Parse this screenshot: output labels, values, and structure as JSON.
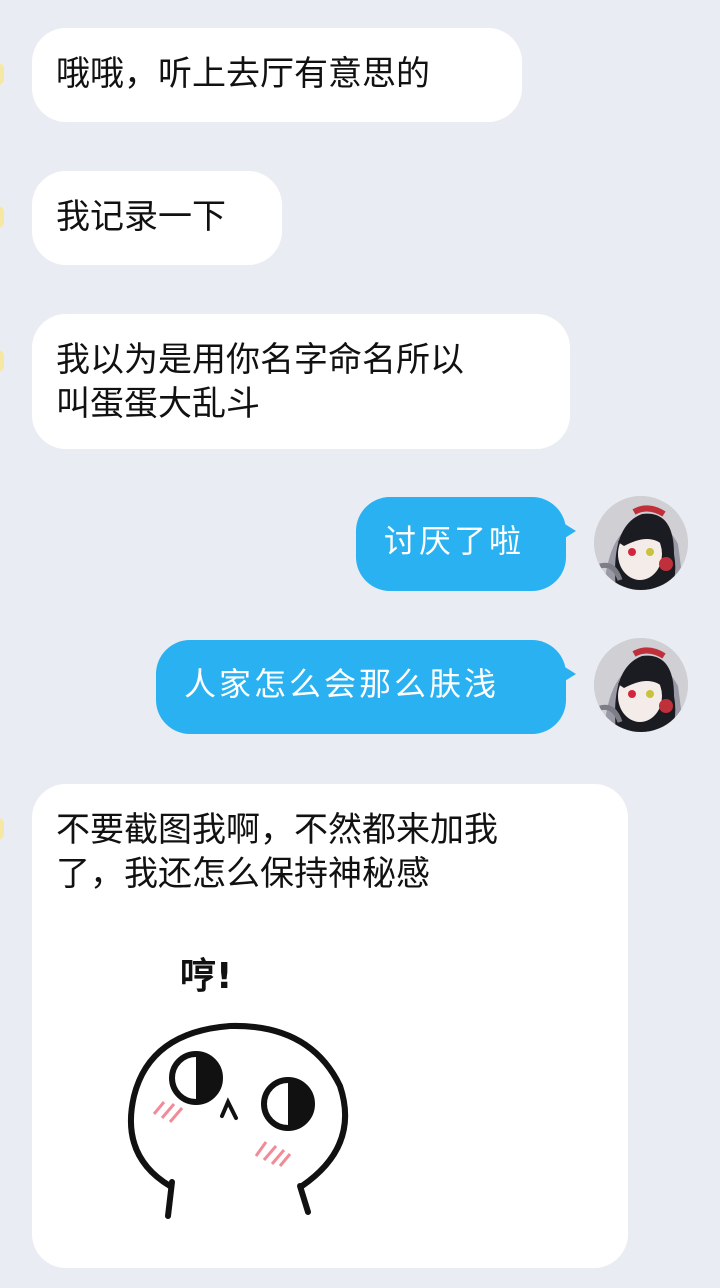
{
  "messages": [
    {
      "side": "in",
      "text": "哦哦，听上去厅有意思的"
    },
    {
      "side": "in",
      "text": "我记录一下"
    },
    {
      "side": "in",
      "text_lines": [
        "我以为是用你名字命名所以",
        "叫蛋蛋大乱斗"
      ]
    },
    {
      "side": "out",
      "text": "讨厌了啦"
    },
    {
      "side": "out",
      "text": "人家怎么会那么肤浅"
    },
    {
      "side": "in",
      "text_lines": [
        "不要截图我啊，不然都来加我",
        "了，我还怎么保持神秘感"
      ],
      "sticker": {
        "text": "哼!"
      }
    }
  ],
  "colors": {
    "background": "#e9edf3",
    "incoming_bubble": "#ffffff",
    "outgoing_bubble": "#29b1f2"
  },
  "icons": {
    "self_avatar": "anime-girl-avatar-icon",
    "sticker": "round-face-sticker-icon"
  }
}
